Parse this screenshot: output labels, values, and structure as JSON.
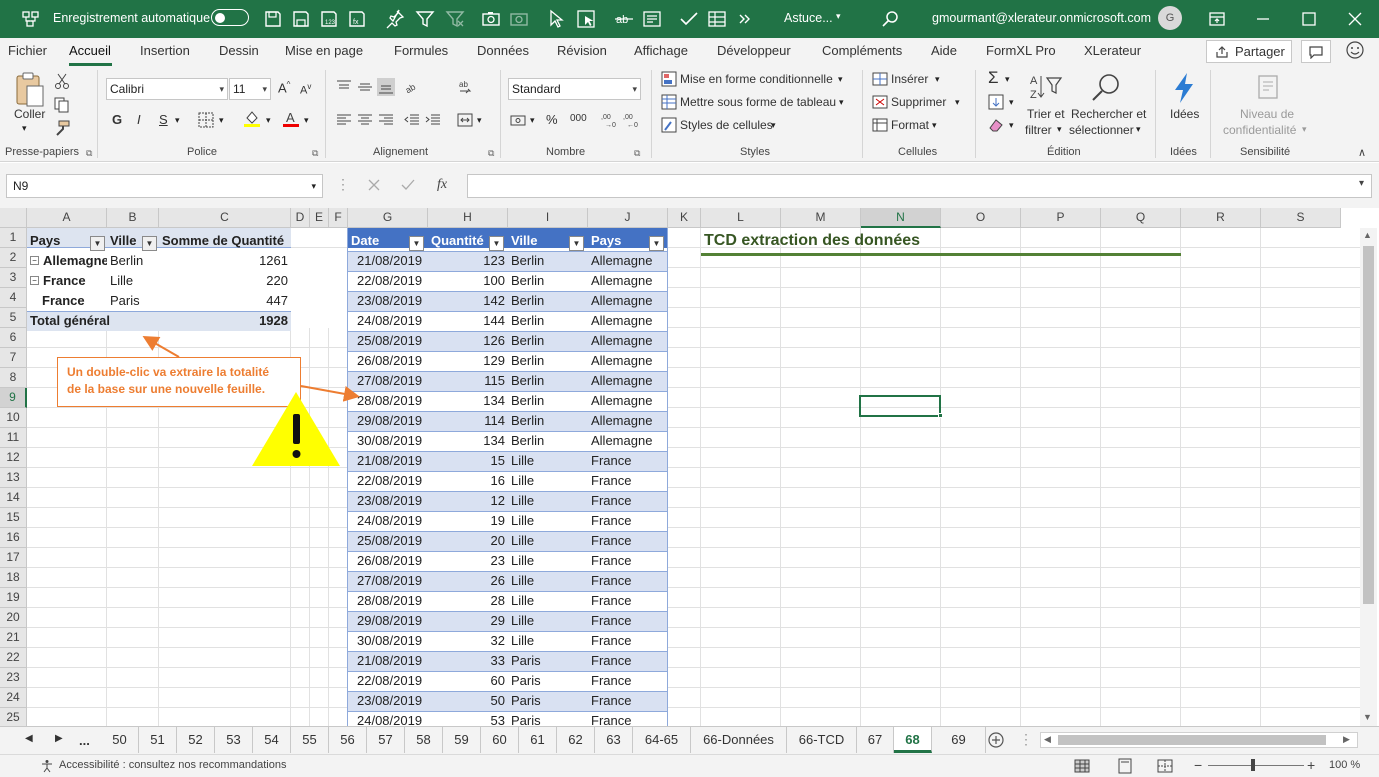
{
  "titlebar": {
    "autosave_label": "Enregistrement automatique",
    "doc_title": "Astuce...",
    "user_email": "gmourmant@xlerateur.onmicrosoft.com",
    "avatar_initial": "G",
    "bg_color": "#217346"
  },
  "menu": {
    "items": [
      "Fichier",
      "Accueil",
      "Insertion",
      "Dessin",
      "Mise en page",
      "Formules",
      "Données",
      "Révision",
      "Affichage",
      "Développeur",
      "Compléments",
      "Aide",
      "FormXL Pro",
      "XLerateur"
    ],
    "active": "Accueil",
    "share_label": "Partager"
  },
  "ribbon": {
    "clipboard": {
      "paste": "Coller",
      "label": "Presse-papiers"
    },
    "font": {
      "name": "Calibri",
      "size": "11",
      "bold": "G",
      "italic": "I",
      "underline": "S",
      "label": "Police"
    },
    "alignment": {
      "label": "Alignement"
    },
    "number": {
      "format": "Standard",
      "percent": "%",
      "thousands": "000",
      "label": "Nombre"
    },
    "styles": {
      "conditional": "Mise en forme conditionnelle",
      "table": "Mettre sous forme de tableau",
      "cell_styles": "Styles de cellules",
      "label": "Styles"
    },
    "cells": {
      "insert": "Insérer",
      "delete": "Supprimer",
      "format": "Format",
      "label": "Cellules"
    },
    "editing": {
      "sort1": "Trier et",
      "sort2": "filtrer",
      "find1": "Rechercher et",
      "find2": "sélectionner",
      "label": "Édition"
    },
    "ideas": {
      "button": "Idées",
      "label": "Idées"
    },
    "sensitivity": {
      "btn1": "Niveau de",
      "btn2": "confidentialité",
      "label": "Sensibilité"
    }
  },
  "formula_bar": {
    "name_box": "N9",
    "fx": "fx",
    "formula": ""
  },
  "columns": [
    "A",
    "B",
    "C",
    "D",
    "E",
    "F",
    "G",
    "H",
    "I",
    "J",
    "K",
    "L",
    "M",
    "N",
    "O",
    "P",
    "Q",
    "R",
    "S"
  ],
  "selected_cell": "N9",
  "rows": [
    "1",
    "2",
    "3",
    "4",
    "5",
    "6",
    "7",
    "8",
    "9",
    "10",
    "11",
    "12",
    "13",
    "14",
    "15",
    "16",
    "17",
    "18",
    "19",
    "20",
    "21",
    "22",
    "23",
    "24",
    "25"
  ],
  "pivot": {
    "headers": [
      "Pays",
      "Ville",
      "Somme de Quantité"
    ],
    "rows": [
      {
        "pays": "Allemagne",
        "ville": "Berlin",
        "qty": "1261"
      },
      {
        "pays": "France",
        "ville": "Lille",
        "qty": "220"
      },
      {
        "pays": "France",
        "ville": "Paris",
        "qty": "447"
      }
    ],
    "total_label": "Total général",
    "total_value": "1928",
    "header_color": "#dde4f0"
  },
  "table": {
    "headers": [
      "Date",
      "Quantité",
      "Ville",
      "Pays"
    ],
    "header_color": "#4472c4",
    "band_color": "#d9e1f2",
    "rows": [
      [
        "21/08/2019",
        "123",
        "Berlin",
        "Allemagne"
      ],
      [
        "22/08/2019",
        "100",
        "Berlin",
        "Allemagne"
      ],
      [
        "23/08/2019",
        "142",
        "Berlin",
        "Allemagne"
      ],
      [
        "24/08/2019",
        "144",
        "Berlin",
        "Allemagne"
      ],
      [
        "25/08/2019",
        "126",
        "Berlin",
        "Allemagne"
      ],
      [
        "26/08/2019",
        "129",
        "Berlin",
        "Allemagne"
      ],
      [
        "27/08/2019",
        "115",
        "Berlin",
        "Allemagne"
      ],
      [
        "28/08/2019",
        "134",
        "Berlin",
        "Allemagne"
      ],
      [
        "29/08/2019",
        "114",
        "Berlin",
        "Allemagne"
      ],
      [
        "30/08/2019",
        "134",
        "Berlin",
        "Allemagne"
      ],
      [
        "21/08/2019",
        "15",
        "Lille",
        "France"
      ],
      [
        "22/08/2019",
        "16",
        "Lille",
        "France"
      ],
      [
        "23/08/2019",
        "12",
        "Lille",
        "France"
      ],
      [
        "24/08/2019",
        "19",
        "Lille",
        "France"
      ],
      [
        "25/08/2019",
        "20",
        "Lille",
        "France"
      ],
      [
        "26/08/2019",
        "23",
        "Lille",
        "France"
      ],
      [
        "27/08/2019",
        "26",
        "Lille",
        "France"
      ],
      [
        "28/08/2019",
        "28",
        "Lille",
        "France"
      ],
      [
        "29/08/2019",
        "29",
        "Lille",
        "France"
      ],
      [
        "30/08/2019",
        "32",
        "Lille",
        "France"
      ],
      [
        "21/08/2019",
        "33",
        "Paris",
        "France"
      ],
      [
        "22/08/2019",
        "60",
        "Paris",
        "France"
      ],
      [
        "23/08/2019",
        "50",
        "Paris",
        "France"
      ],
      [
        "24/08/2019",
        "53",
        "Paris",
        "France"
      ]
    ]
  },
  "heading": {
    "text": "TCD extraction des données",
    "color": "#375623"
  },
  "callout": {
    "line1": "Un double-clic va extraire la totalité",
    "line2": "de la base sur une nouvelle feuille.",
    "color": "#ed7d31"
  },
  "sheet_tabs": [
    "50",
    "51",
    "52",
    "53",
    "54",
    "55",
    "56",
    "57",
    "58",
    "59",
    "60",
    "61",
    "62",
    "63",
    "64-65",
    "66-Données",
    "66-TCD",
    "67",
    "68",
    "69"
  ],
  "nav_ellipsis": "...",
  "active_sheet": "68",
  "status": {
    "accessibility": "Accessibilité : consultez nos recommandations",
    "zoom": "100 %"
  }
}
